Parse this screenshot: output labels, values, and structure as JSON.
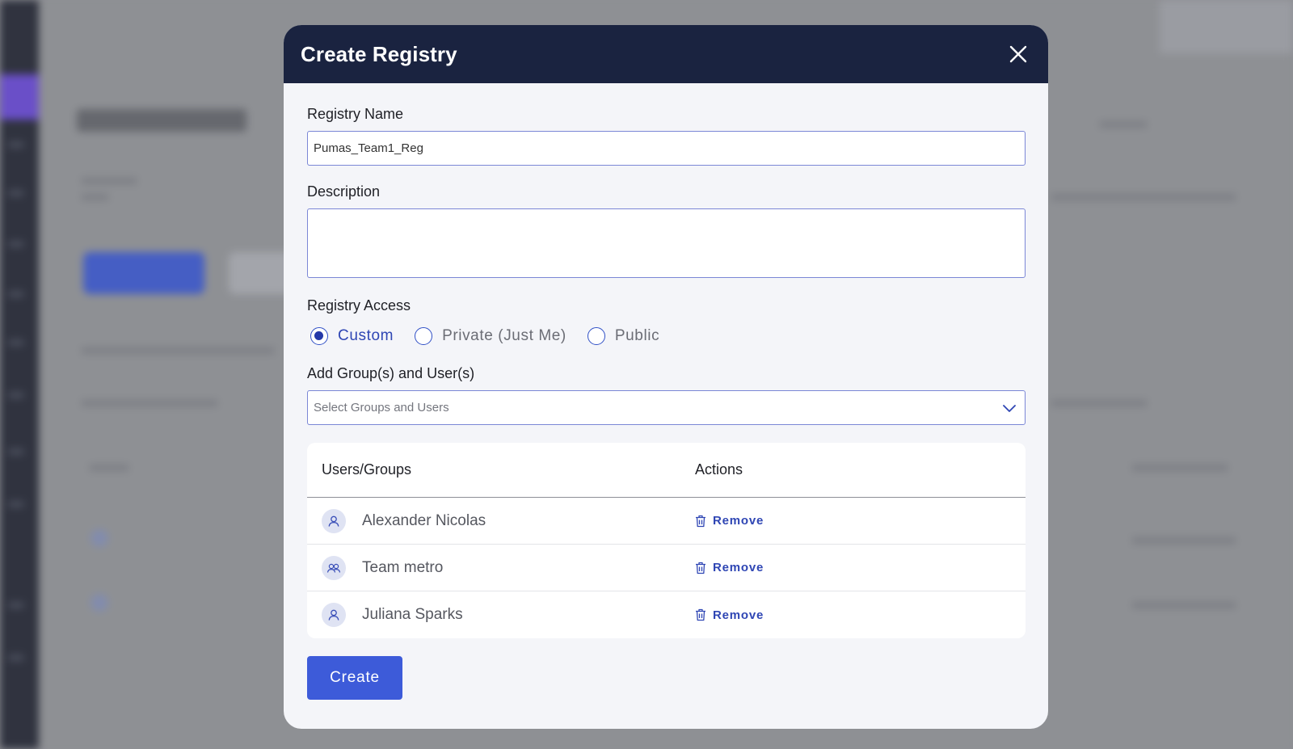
{
  "modal": {
    "title": "Create Registry"
  },
  "form": {
    "registry_name_label": "Registry Name",
    "registry_name_value": "Pumas_Team1_Reg",
    "description_label": "Description",
    "description_value": "",
    "access_label": "Registry Access",
    "access_options": [
      {
        "label": "Custom",
        "selected": true
      },
      {
        "label": "Private (Just Me)",
        "selected": false
      },
      {
        "label": "Public",
        "selected": false
      }
    ],
    "add_label": "Add Group(s) and User(s)",
    "add_placeholder": "Select Groups and Users"
  },
  "table": {
    "col_users": "Users/Groups",
    "col_actions": "Actions",
    "rows": [
      {
        "name": "Alexander Nicolas",
        "type": "user",
        "action": "Remove"
      },
      {
        "name": "Team metro",
        "type": "group",
        "action": "Remove"
      },
      {
        "name": "Juliana Sparks",
        "type": "user",
        "action": "Remove"
      }
    ]
  },
  "actions": {
    "create_label": "Create"
  },
  "colors": {
    "header_bg": "#1a2340",
    "accent": "#3d5bd9",
    "link": "#2f46b4"
  },
  "icons": {
    "close": "close-icon",
    "chevron": "chevron-down-icon",
    "user": "user-icon",
    "group": "group-icon",
    "trash": "trash-icon"
  }
}
